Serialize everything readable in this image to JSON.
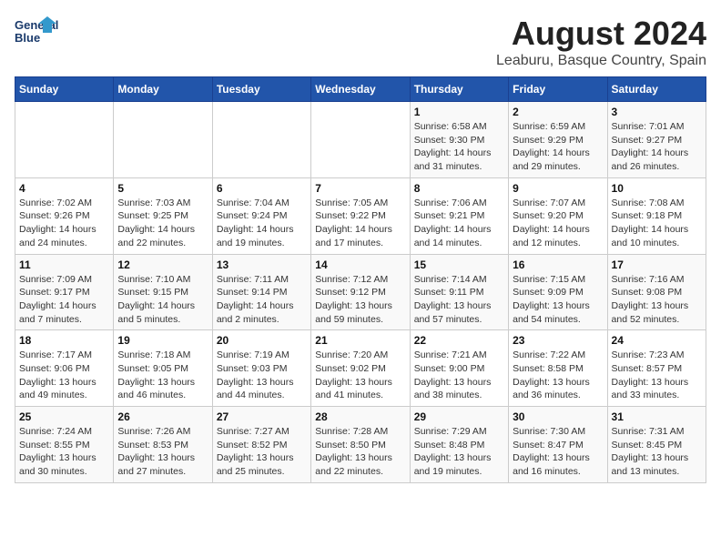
{
  "header": {
    "logo_line1": "General",
    "logo_line2": "Blue",
    "title": "August 2024",
    "subtitle": "Leaburu, Basque Country, Spain"
  },
  "weekdays": [
    "Sunday",
    "Monday",
    "Tuesday",
    "Wednesday",
    "Thursday",
    "Friday",
    "Saturday"
  ],
  "weeks": [
    [
      {
        "day": "",
        "info": ""
      },
      {
        "day": "",
        "info": ""
      },
      {
        "day": "",
        "info": ""
      },
      {
        "day": "",
        "info": ""
      },
      {
        "day": "1",
        "info": "Sunrise: 6:58 AM\nSunset: 9:30 PM\nDaylight: 14 hours\nand 31 minutes."
      },
      {
        "day": "2",
        "info": "Sunrise: 6:59 AM\nSunset: 9:29 PM\nDaylight: 14 hours\nand 29 minutes."
      },
      {
        "day": "3",
        "info": "Sunrise: 7:01 AM\nSunset: 9:27 PM\nDaylight: 14 hours\nand 26 minutes."
      }
    ],
    [
      {
        "day": "4",
        "info": "Sunrise: 7:02 AM\nSunset: 9:26 PM\nDaylight: 14 hours\nand 24 minutes."
      },
      {
        "day": "5",
        "info": "Sunrise: 7:03 AM\nSunset: 9:25 PM\nDaylight: 14 hours\nand 22 minutes."
      },
      {
        "day": "6",
        "info": "Sunrise: 7:04 AM\nSunset: 9:24 PM\nDaylight: 14 hours\nand 19 minutes."
      },
      {
        "day": "7",
        "info": "Sunrise: 7:05 AM\nSunset: 9:22 PM\nDaylight: 14 hours\nand 17 minutes."
      },
      {
        "day": "8",
        "info": "Sunrise: 7:06 AM\nSunset: 9:21 PM\nDaylight: 14 hours\nand 14 minutes."
      },
      {
        "day": "9",
        "info": "Sunrise: 7:07 AM\nSunset: 9:20 PM\nDaylight: 14 hours\nand 12 minutes."
      },
      {
        "day": "10",
        "info": "Sunrise: 7:08 AM\nSunset: 9:18 PM\nDaylight: 14 hours\nand 10 minutes."
      }
    ],
    [
      {
        "day": "11",
        "info": "Sunrise: 7:09 AM\nSunset: 9:17 PM\nDaylight: 14 hours\nand 7 minutes."
      },
      {
        "day": "12",
        "info": "Sunrise: 7:10 AM\nSunset: 9:15 PM\nDaylight: 14 hours\nand 5 minutes."
      },
      {
        "day": "13",
        "info": "Sunrise: 7:11 AM\nSunset: 9:14 PM\nDaylight: 14 hours\nand 2 minutes."
      },
      {
        "day": "14",
        "info": "Sunrise: 7:12 AM\nSunset: 9:12 PM\nDaylight: 13 hours\nand 59 minutes."
      },
      {
        "day": "15",
        "info": "Sunrise: 7:14 AM\nSunset: 9:11 PM\nDaylight: 13 hours\nand 57 minutes."
      },
      {
        "day": "16",
        "info": "Sunrise: 7:15 AM\nSunset: 9:09 PM\nDaylight: 13 hours\nand 54 minutes."
      },
      {
        "day": "17",
        "info": "Sunrise: 7:16 AM\nSunset: 9:08 PM\nDaylight: 13 hours\nand 52 minutes."
      }
    ],
    [
      {
        "day": "18",
        "info": "Sunrise: 7:17 AM\nSunset: 9:06 PM\nDaylight: 13 hours\nand 49 minutes."
      },
      {
        "day": "19",
        "info": "Sunrise: 7:18 AM\nSunset: 9:05 PM\nDaylight: 13 hours\nand 46 minutes."
      },
      {
        "day": "20",
        "info": "Sunrise: 7:19 AM\nSunset: 9:03 PM\nDaylight: 13 hours\nand 44 minutes."
      },
      {
        "day": "21",
        "info": "Sunrise: 7:20 AM\nSunset: 9:02 PM\nDaylight: 13 hours\nand 41 minutes."
      },
      {
        "day": "22",
        "info": "Sunrise: 7:21 AM\nSunset: 9:00 PM\nDaylight: 13 hours\nand 38 minutes."
      },
      {
        "day": "23",
        "info": "Sunrise: 7:22 AM\nSunset: 8:58 PM\nDaylight: 13 hours\nand 36 minutes."
      },
      {
        "day": "24",
        "info": "Sunrise: 7:23 AM\nSunset: 8:57 PM\nDaylight: 13 hours\nand 33 minutes."
      }
    ],
    [
      {
        "day": "25",
        "info": "Sunrise: 7:24 AM\nSunset: 8:55 PM\nDaylight: 13 hours\nand 30 minutes."
      },
      {
        "day": "26",
        "info": "Sunrise: 7:26 AM\nSunset: 8:53 PM\nDaylight: 13 hours\nand 27 minutes."
      },
      {
        "day": "27",
        "info": "Sunrise: 7:27 AM\nSunset: 8:52 PM\nDaylight: 13 hours\nand 25 minutes."
      },
      {
        "day": "28",
        "info": "Sunrise: 7:28 AM\nSunset: 8:50 PM\nDaylight: 13 hours\nand 22 minutes."
      },
      {
        "day": "29",
        "info": "Sunrise: 7:29 AM\nSunset: 8:48 PM\nDaylight: 13 hours\nand 19 minutes."
      },
      {
        "day": "30",
        "info": "Sunrise: 7:30 AM\nSunset: 8:47 PM\nDaylight: 13 hours\nand 16 minutes."
      },
      {
        "day": "31",
        "info": "Sunrise: 7:31 AM\nSunset: 8:45 PM\nDaylight: 13 hours\nand 13 minutes."
      }
    ]
  ]
}
